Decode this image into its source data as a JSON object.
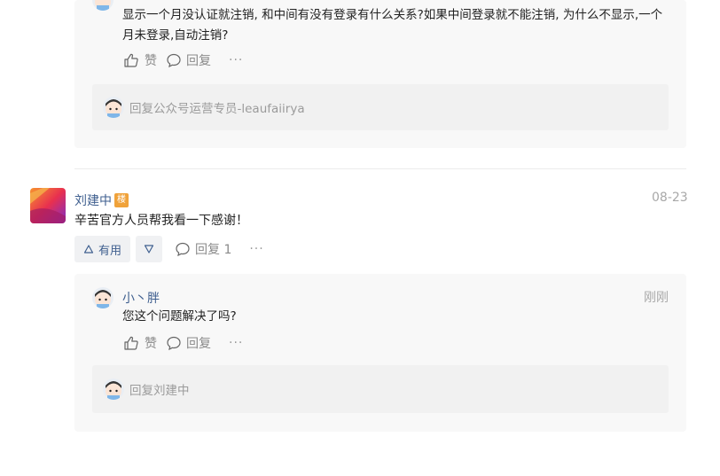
{
  "thread1": {
    "reply": {
      "text": "显示一个月没认证就注销, 和中间有没有登录有什么关系?如果中间登录就不能注销, 为什么不显示,一个月未登录,自动注销?",
      "like_label": "赞",
      "reply_label": "回复",
      "more": "···"
    },
    "reply_box_placeholder": "回复公众号运营专员-leaufaiirya"
  },
  "comment2": {
    "username": "刘建中",
    "badge": "楼",
    "time": "08-23",
    "text": "辛苦官方人员帮我看一下感谢！",
    "useful_label": "有用",
    "reply_label": "回复 1",
    "more": "···",
    "reply": {
      "username": "小丶胖",
      "time": "刚刚",
      "text": "您这个问题解决了吗?",
      "like_label": "赞",
      "reply_label": "回复",
      "more": "···"
    },
    "reply_box_placeholder": "回复刘建中"
  },
  "colors": {
    "link": "#3f5f8f",
    "muted": "#8a8a8a",
    "badge": "#f0a23a"
  }
}
